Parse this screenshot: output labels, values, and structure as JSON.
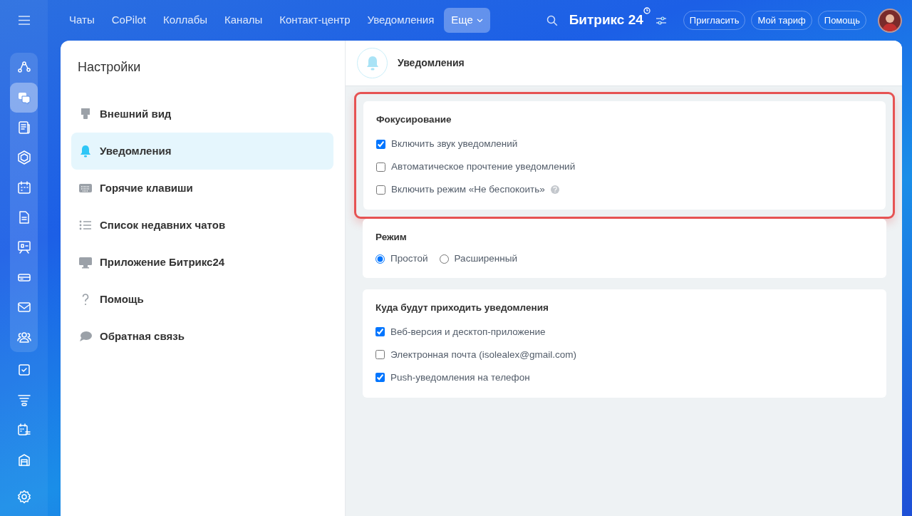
{
  "topbar": {
    "tabs": [
      {
        "label": "Чаты",
        "selected": false
      },
      {
        "label": "CoPilot",
        "selected": false
      },
      {
        "label": "Коллабы",
        "selected": false
      },
      {
        "label": "Каналы",
        "selected": false
      },
      {
        "label": "Контакт-центр",
        "selected": false
      },
      {
        "label": "Уведомления",
        "selected": false
      },
      {
        "label": "Еще",
        "selected": true,
        "kind": "dropdown"
      }
    ],
    "logo": "Битрикс 24",
    "buttons": [
      "Пригласить",
      "Мой тариф",
      "Помощь"
    ]
  },
  "rail": {
    "group": [
      {
        "selected": false
      },
      {
        "selected": true
      },
      {
        "selected": false
      },
      {
        "selected": false
      },
      {
        "selected": false
      },
      {
        "selected": false
      },
      {
        "selected": false
      },
      {
        "selected": false
      },
      {
        "selected": false
      },
      {
        "selected": false
      }
    ],
    "items": [
      {
        "selected": false
      },
      {
        "selected": false
      },
      {
        "selected": false
      },
      {
        "selected": false
      }
    ]
  },
  "settings": {
    "title": "Настройки",
    "items": [
      {
        "label": "Внешний вид",
        "selected": false
      },
      {
        "label": "Уведомления",
        "selected": true
      },
      {
        "label": "Горячие клавиши",
        "selected": false
      },
      {
        "label": "Список недавних чатов",
        "selected": false
      },
      {
        "label": "Приложение Битрикс24",
        "selected": false
      },
      {
        "label": "Помощь",
        "selected": false
      },
      {
        "label": "Обратная связь",
        "selected": false
      }
    ]
  },
  "panel": {
    "title": "Уведомления",
    "sections": [
      {
        "title": "Фокусирование",
        "highlighted": true,
        "options": [
          {
            "kind": "checkbox",
            "label": "Включить звук уведомлений",
            "checked": true
          },
          {
            "kind": "checkbox",
            "label": "Автоматическое прочтение уведомлений",
            "checked": false
          },
          {
            "kind": "checkbox",
            "label": "Включить режим «Не беспокоить»",
            "checked": false,
            "help": true
          }
        ]
      },
      {
        "title": "Режим",
        "highlighted": false,
        "inline": true,
        "options": [
          {
            "kind": "radio",
            "label": "Простой",
            "selected": true
          },
          {
            "kind": "radio",
            "label": "Расширенный",
            "selected": false
          }
        ]
      },
      {
        "title": "Куда будут приходить уведомления",
        "highlighted": false,
        "options": [
          {
            "kind": "checkbox",
            "label": "Веб-версия и десктоп-приложение",
            "checked": true
          },
          {
            "kind": "checkbox",
            "label": "Электронная почта (isolealex@gmail.com)",
            "checked": false
          },
          {
            "kind": "checkbox",
            "label": "Push-уведомления на телефон",
            "checked": true
          }
        ]
      }
    ]
  }
}
